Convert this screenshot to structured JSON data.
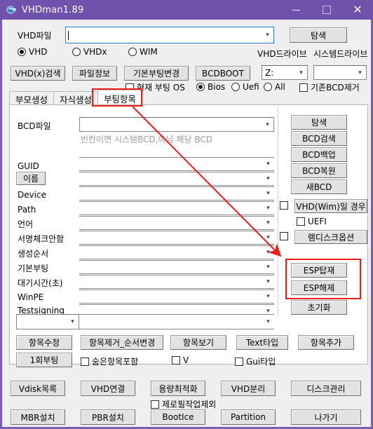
{
  "window": {
    "title": "VHDman1.89",
    "icon": "vhd-app-icon",
    "controls": {
      "minimize": "–",
      "maximize": "□",
      "close": "✕"
    },
    "accent_color": "#7052ad"
  },
  "top": {
    "vhd_file_label": "VHD파일",
    "vhd_file_value": "",
    "browse_label": "탐색",
    "type_radios": [
      {
        "label": "VHD",
        "checked": true
      },
      {
        "label": "VHDx",
        "checked": false
      },
      {
        "label": "WIM",
        "checked": false
      }
    ],
    "vhd_drive_label": "VHD드라이브",
    "system_drive_label": "시스템드라이브",
    "vhd_drive_value": "Z:",
    "system_drive_value": "",
    "buttons": [
      {
        "label": "VHD(x)검색"
      },
      {
        "label": "파일정보"
      },
      {
        "label": "기본부팅변경"
      },
      {
        "label": "BCDBOOT"
      }
    ],
    "current_boot_os": {
      "label": "현재 부팅 OS",
      "checked": false
    },
    "firmware_radios": [
      {
        "label": "Bios",
        "checked": true
      },
      {
        "label": "Uefi",
        "checked": false
      },
      {
        "label": "All",
        "checked": false
      }
    ],
    "remove_bcd": {
      "label": "기존BCD제거",
      "checked": false
    }
  },
  "tabs": [
    {
      "label": "부모생성",
      "active": false
    },
    {
      "label": "자식생성",
      "active": false
    },
    {
      "label": "부팅항목",
      "active": true
    }
  ],
  "boot_panel": {
    "bcd_file_label": "BCD파일",
    "bcd_file_value": "",
    "bcd_hint": "빈칸이면 시스템BCD,아님 해당 BCD",
    "fields": [
      {
        "label": "GUID",
        "value": "",
        "is_button": false
      },
      {
        "label": "이름",
        "value": "",
        "is_button": true
      },
      {
        "label": "Device",
        "value": "",
        "is_button": false
      },
      {
        "label": "Path",
        "value": "",
        "is_button": false
      },
      {
        "label": "언어",
        "value": "",
        "is_button": false
      },
      {
        "label": "서명체크안함",
        "value": "",
        "is_button": false
      },
      {
        "label": "생성순서",
        "value": "",
        "is_button": false
      },
      {
        "label": "기본부팅",
        "value": "",
        "is_button": false
      },
      {
        "label": "대기시간(초)",
        "value": "",
        "is_button": false
      },
      {
        "label": "WinPE",
        "value": "",
        "is_button": false
      },
      {
        "label": "Testsigning",
        "value": "",
        "is_button": false
      }
    ],
    "extra_small_combo_value": "",
    "extra_wide_combo_value": "",
    "right_buttons": [
      {
        "label": "탐색"
      },
      {
        "label": "BCD검색"
      },
      {
        "label": "BCD백업"
      },
      {
        "label": "BCD복원"
      },
      {
        "label": "새BCD"
      }
    ],
    "vhd_wim_case": {
      "label": "VHD(Wim)일 경우",
      "checked": false
    },
    "uefi": {
      "label": "UEFI",
      "checked": false
    },
    "ramdisk_option": {
      "label": "램디스크옵션",
      "checked": false
    },
    "esp_mount": "ESP탑재",
    "esp_unmount": "ESP해제",
    "reset": "초기화",
    "action_buttons": [
      {
        "label": "항목수정"
      },
      {
        "label": "항목제거_순서변경"
      },
      {
        "label": "항목보기"
      },
      {
        "label": "Text타입"
      },
      {
        "label": "항목추가"
      }
    ],
    "one_time_boot": "1회부팅",
    "include_hidden": {
      "label": "숨은항목포함",
      "checked": false
    },
    "v_option": {
      "label": "V",
      "checked": false
    },
    "gui_type": {
      "label": "Gui타입",
      "checked": false
    }
  },
  "bottom": {
    "row1": [
      {
        "label": "Vdisk목록"
      },
      {
        "label": "VHD연결"
      },
      {
        "label": "용량최적화"
      },
      {
        "label": "VHD분리"
      },
      {
        "label": "디스크관리"
      }
    ],
    "zerofill_exclude": {
      "label": "제로필작업제외",
      "checked": false
    },
    "row2": [
      {
        "label": "MBR설치"
      },
      {
        "label": "PBR설치"
      },
      {
        "label": "BootIce"
      },
      {
        "label": "Partition"
      },
      {
        "label": "나가기"
      }
    ]
  },
  "annotations": {
    "highlight_color": "#ef1c1c",
    "boxes": [
      {
        "name": "tab-boot-entries-highlight"
      },
      {
        "name": "esp-buttons-highlight"
      }
    ],
    "arrow": {
      "from": "부팅항목",
      "to": "ESP탑재"
    }
  }
}
